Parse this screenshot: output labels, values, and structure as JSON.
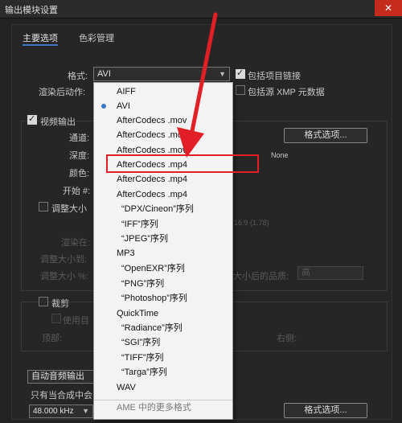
{
  "window": {
    "title": "输出模块设置",
    "close_glyph": "✕"
  },
  "tabs": [
    {
      "label": "主要选项"
    },
    {
      "label": "色彩管理"
    }
  ],
  "format": {
    "label": "格式:",
    "value": "AVI"
  },
  "post_render": {
    "label": "渲染后动作:"
  },
  "include_project_link": {
    "label": "包括项目链接",
    "checked": true
  },
  "include_xmp": {
    "label": "包括源 XMP 元数据",
    "checked": false
  },
  "video_output": {
    "label": "视频输出",
    "checked": true,
    "channel_label": "通道:",
    "depth_label": "深度:",
    "color_label": "颜色:",
    "start_label": "开始 #:",
    "format_options_button": "格式选项...",
    "codec_status": "None"
  },
  "resize": {
    "label": "调整大小",
    "render_at_label": "渲染在:",
    "resize_to_label": "调整大小到:",
    "resize_pct_label": "调整大小 %:",
    "aspect": "16:9 (1.78)",
    "quality_label": "大小后的品质:",
    "quality_value": "高"
  },
  "crop": {
    "label": "裁剪",
    "use_label": "使用目",
    "top_label": "顶部:",
    "right_label": "右侧:"
  },
  "audio": {
    "select_value": "自动音频输出",
    "note": "只有当合成中会",
    "rate_value": "48.000 kHz",
    "format_options_button": "格式选项..."
  },
  "format_dropdown": {
    "options": [
      {
        "label": "AIFF"
      },
      {
        "label": "AVI",
        "selected": true
      },
      {
        "label": "AfterCodecs .mov"
      },
      {
        "label": "AfterCodecs .mov"
      },
      {
        "label": "AfterCodecs .mov"
      },
      {
        "label": "AfterCodecs .mp4"
      },
      {
        "label": "AfterCodecs .mp4"
      },
      {
        "label": "AfterCodecs .mp4"
      },
      {
        "label": "“DPX/Cineon”序列",
        "indent": true
      },
      {
        "label": "“IFF”序列",
        "indent": true
      },
      {
        "label": "“JPEG”序列",
        "indent": true
      },
      {
        "label": "MP3"
      },
      {
        "label": "“OpenEXR”序列",
        "indent": true
      },
      {
        "label": "“PNG”序列",
        "indent": true
      },
      {
        "label": "“Photoshop”序列",
        "indent": true
      },
      {
        "label": "QuickTime"
      },
      {
        "label": "“Radiance”序列",
        "indent": true
      },
      {
        "label": "“SGI”序列",
        "indent": true
      },
      {
        "label": "“TIFF”序列",
        "indent": true
      },
      {
        "label": "“Targa”序列",
        "indent": true
      },
      {
        "label": "WAV"
      }
    ],
    "more_formats": "AME 中的更多格式"
  },
  "annotation": {
    "color": "#e21f26"
  }
}
